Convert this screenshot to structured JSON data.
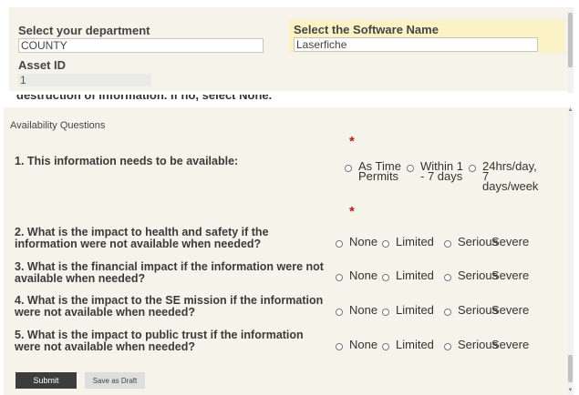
{
  "form": {
    "department_label": "Select your department",
    "department_value": "COUNTY",
    "software_label": "Select the Software Name",
    "software_value": "Laserfiche",
    "asset_label": "Asset ID",
    "asset_value": "1"
  },
  "partial_text": "destruction of information. If no, select None.",
  "section": {
    "title": "Availability Questions",
    "required_marker": "*"
  },
  "questions": [
    {
      "text": "1. This information needs to be available:",
      "options": [
        "As Time Permits",
        "Within 1 - 7 days",
        "24hrs/day, 7 days/week"
      ]
    },
    {
      "text": "2. What is the impact to health and safety if the information were not available when needed?",
      "options": [
        "None",
        "Limited",
        "Serious",
        "Severe"
      ]
    },
    {
      "text": "3. What is the financial impact if the information were not available when needed?",
      "options": [
        "None",
        "Limited",
        "Serious",
        "Severe"
      ]
    },
    {
      "text": "4. What is the impact to the SE mission if the information were not available when needed?",
      "options": [
        "None",
        "Limited",
        "Serious",
        "Severe"
      ]
    },
    {
      "text": "5. What is the impact to public trust if the information were not available when needed?",
      "options": [
        "None",
        "Limited",
        "Serious",
        "Severe"
      ]
    }
  ],
  "buttons": {
    "submit": "Submit",
    "save_draft": "Save as Draft"
  },
  "colors": {
    "panel_bg": "#f6f4ea",
    "highlight_bg": "#fbf3c6",
    "required": "#b01e1e",
    "submit_bg": "#3d3d3d"
  }
}
